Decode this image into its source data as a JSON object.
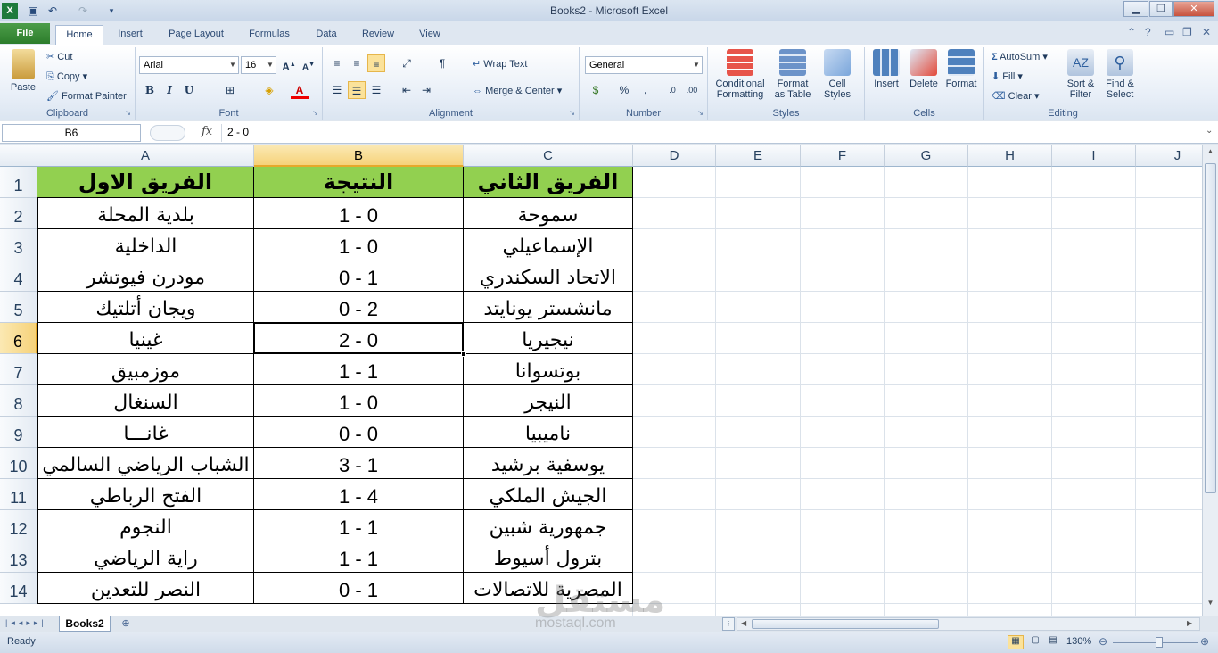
{
  "window": {
    "title": "Books2  -  Microsoft Excel"
  },
  "tabs": [
    "File",
    "Home",
    "Insert",
    "Page Layout",
    "Formulas",
    "Data",
    "Review",
    "View"
  ],
  "ribbon": {
    "clipboard": {
      "paste": "Paste",
      "cut": "Cut",
      "copy": "Copy",
      "format_painter": "Format Painter",
      "label": "Clipboard"
    },
    "font": {
      "name": "Arial",
      "size": "16",
      "label": "Font",
      "bold": "B",
      "italic": "I",
      "underline": "U"
    },
    "alignment": {
      "wrap": "Wrap Text",
      "merge": "Merge & Center",
      "label": "Alignment"
    },
    "number": {
      "format": "General",
      "percent": "%",
      "comma": ",",
      "label": "Number"
    },
    "styles": {
      "conditional": "Conditional\nFormatting",
      "format_table": "Format\nas Table",
      "cell_styles": "Cell\nStyles",
      "label": "Styles"
    },
    "cells": {
      "insert": "Insert",
      "delete": "Delete",
      "format": "Format",
      "label": "Cells"
    },
    "editing": {
      "autosum": "AutoSum",
      "fill": "Fill",
      "clear": "Clear",
      "sort": "Sort &\nFilter",
      "find": "Find &\nSelect",
      "label": "Editing"
    }
  },
  "formula_bar": {
    "name_box": "B6",
    "fx": "fx",
    "formula": "2 - 0"
  },
  "columns": [
    "A",
    "B",
    "C",
    "D",
    "E",
    "F",
    "G",
    "H",
    "I",
    "J"
  ],
  "selected_cell": "B6",
  "sheet": {
    "header": [
      "الفريق الاول",
      "النتيجة",
      "الفريق الثاني"
    ],
    "rows": [
      [
        "بلدية المحلة",
        "1 - 0",
        "سموحة"
      ],
      [
        "الداخلية",
        "1 - 0",
        "الإسماعيلي"
      ],
      [
        "مودرن فيوتشر",
        "0 - 1",
        "الاتحاد السكندري"
      ],
      [
        "ويجان أتلتيك",
        "0 - 2",
        "مانشستر يونايتد"
      ],
      [
        "غينيا",
        "2 - 0",
        "نيجيريا"
      ],
      [
        "موزمبيق",
        "1 - 1",
        "بوتسوانا"
      ],
      [
        "السنغال",
        "1 - 0",
        "النيجر"
      ],
      [
        "غانـــا",
        "0 - 0",
        "ناميبيا"
      ],
      [
        "الشباب الرياضي السالمي",
        "3 - 1",
        "يوسفية برشيد"
      ],
      [
        "الفتح الرباطي",
        "1 - 4",
        "الجيش الملكي"
      ],
      [
        "النجوم",
        "1 - 1",
        "جمهورية شبين"
      ],
      [
        "راية الرياضي",
        "1 - 1",
        "بترول أسيوط"
      ],
      [
        "النصر للتعدين",
        "0 - 1",
        "المصرية للاتصالات"
      ]
    ]
  },
  "row_numbers": [
    "1",
    "2",
    "3",
    "4",
    "5",
    "6",
    "7",
    "8",
    "9",
    "10",
    "11",
    "12",
    "13",
    "14"
  ],
  "sheet_tabs": [
    "Books2"
  ],
  "status": {
    "ready": "Ready",
    "zoom": "130%"
  },
  "watermark": {
    "logo": "مستقل",
    "url": "mostaql.com"
  }
}
